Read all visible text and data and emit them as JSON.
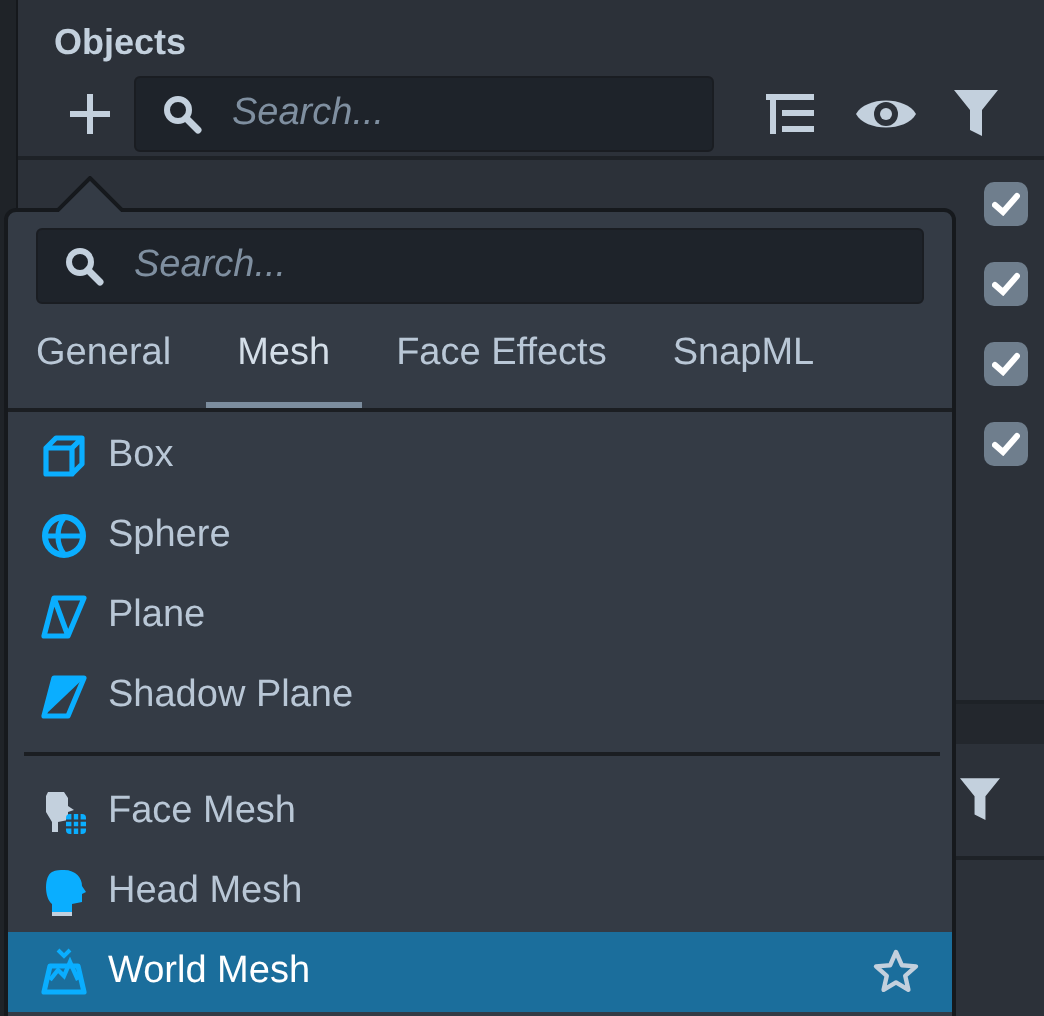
{
  "panel": {
    "title": "Objects",
    "search": {
      "placeholder": "Search..."
    },
    "objects": [
      {
        "checked": true
      },
      {
        "checked": true
      },
      {
        "checked": true
      },
      {
        "checked": true
      }
    ]
  },
  "popup": {
    "search": {
      "placeholder": "Search..."
    },
    "tabs": [
      {
        "label": "General",
        "selected": false
      },
      {
        "label": "Mesh",
        "selected": true
      },
      {
        "label": "Face Effects",
        "selected": false
      },
      {
        "label": "SnapML",
        "selected": false
      }
    ],
    "groups": [
      [
        {
          "label": "Box",
          "kind": "box",
          "selected": false
        },
        {
          "label": "Sphere",
          "kind": "sphere",
          "selected": false
        },
        {
          "label": "Plane",
          "kind": "plane",
          "selected": false
        },
        {
          "label": "Shadow Plane",
          "kind": "shadow-plane",
          "selected": false
        }
      ],
      [
        {
          "label": "Face Mesh",
          "kind": "face-mesh",
          "selected": false
        },
        {
          "label": "Head Mesh",
          "kind": "head-mesh",
          "selected": false
        },
        {
          "label": "World Mesh",
          "kind": "world-mesh",
          "selected": true
        }
      ]
    ]
  }
}
